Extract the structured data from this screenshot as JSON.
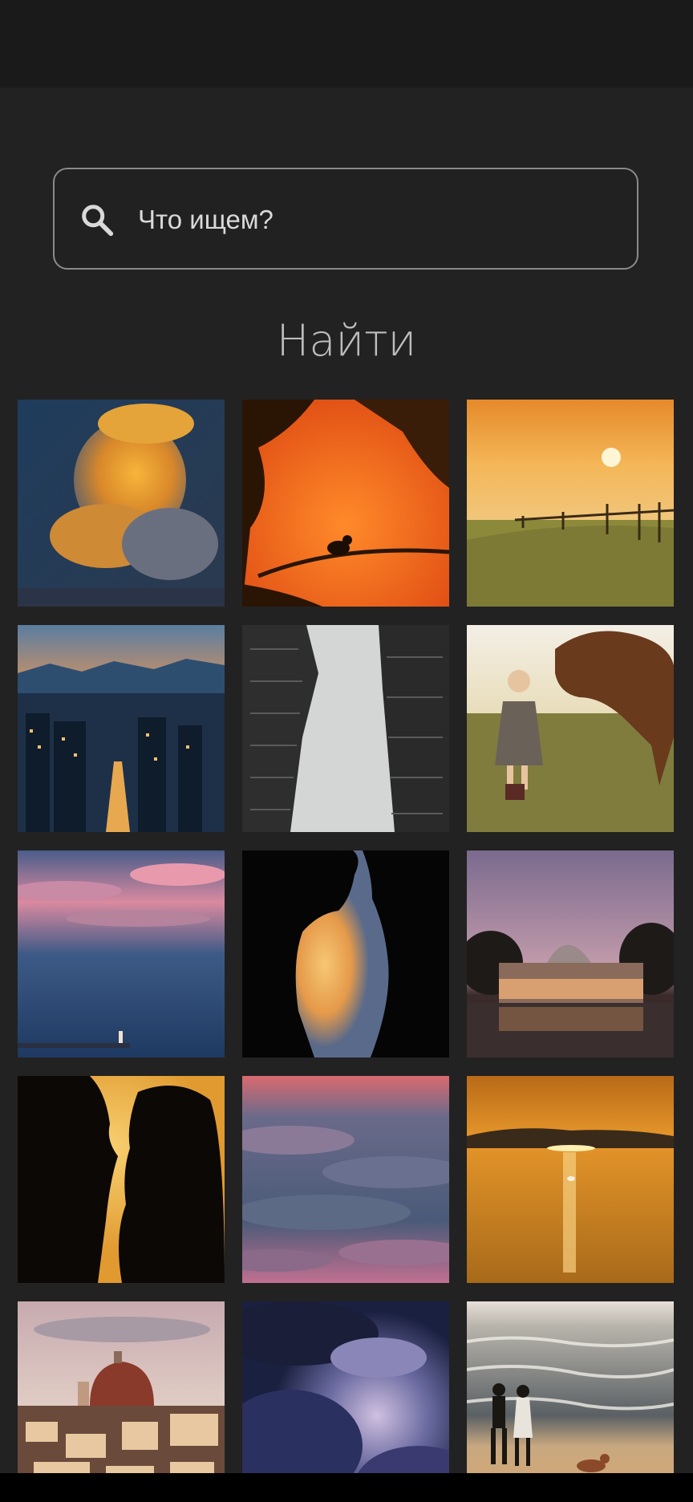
{
  "search": {
    "placeholder": "Что ищем?",
    "icon": "search-icon"
  },
  "find_button": {
    "label": "Найти"
  },
  "photos": [
    {
      "subject": "sunset-cumulus-cloud"
    },
    {
      "subject": "bird-on-branch-orange-sky"
    },
    {
      "subject": "sunset-over-field-fence"
    },
    {
      "subject": "city-skyline-dusk"
    },
    {
      "subject": "skyscrapers-looking-up"
    },
    {
      "subject": "girl-with-horse"
    },
    {
      "subject": "pink-clouds-sea-lighthouse"
    },
    {
      "subject": "couple-silhouette-kiss"
    },
    {
      "subject": "glass-palace-at-dusk"
    },
    {
      "subject": "couple-silhouette-sunset"
    },
    {
      "subject": "sea-of-clouds-pink"
    },
    {
      "subject": "golden-sunset-over-water-swan"
    },
    {
      "subject": "florence-cathedral-dusk"
    },
    {
      "subject": "dramatic-storm-clouds"
    },
    {
      "subject": "couple-walking-dog-on-beach"
    }
  ]
}
